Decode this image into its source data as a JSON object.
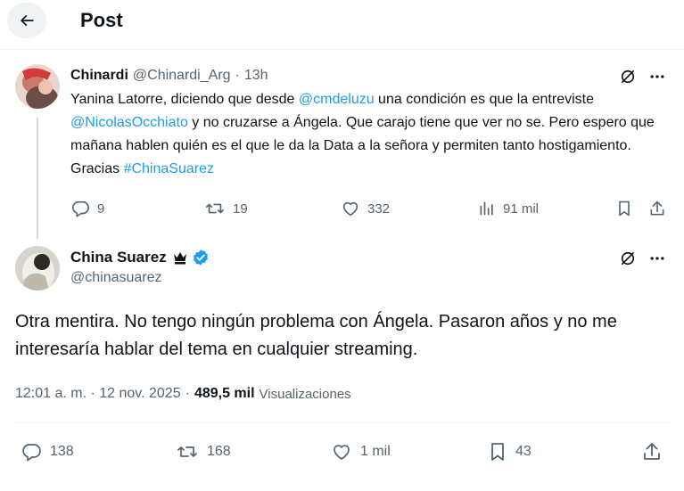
{
  "header": {
    "title": "Post"
  },
  "reply": {
    "author_name": "Chinardi",
    "author_handle": "@Chinardi_Arg",
    "separator": "·",
    "time": "13h",
    "text_parts": [
      {
        "text": "Yanina Latorre, diciendo que desde ",
        "link": false
      },
      {
        "text": "@cmdeluzu",
        "link": true
      },
      {
        "text": " una condición es que la entreviste ",
        "link": false
      },
      {
        "text": "@NicolasOcchiato",
        "link": true
      },
      {
        "text": " y no cruzarse a Ángela. Que carajo tiene que ver no se. Pero espero que mañana hablen quién es el que le da la Data a la señora y permiten tanto hostigamiento. Gracias ",
        "link": false
      },
      {
        "text": "#ChinaSuarez",
        "link": true
      }
    ],
    "stats": {
      "replies": "9",
      "reposts": "19",
      "likes": "332",
      "views": "91 mil"
    }
  },
  "main": {
    "author_name": "China Suarez",
    "author_handle": "@chinasuarez",
    "text": "Otra mentira. No tengo ningún problema con Ángela. Pasaron años y no me interesaría hablar del tema en cualquier streaming.",
    "timestamp": "12:01 a. m. · 12 nov. 2025",
    "separator": "·",
    "views_count": "489,5 mil",
    "views_label": "Visualizaciones",
    "stats": {
      "replies": "138",
      "reposts": "168",
      "likes": "1 mil",
      "bookmarks": "43"
    }
  },
  "colors": {
    "link": "#1d9bf0",
    "verified": "#1d9bf0",
    "muted": "#536471",
    "text": "#0f1419"
  },
  "icons": [
    "back-arrow-icon",
    "grok-icon",
    "more-icon",
    "reply-icon",
    "repost-icon",
    "like-icon",
    "views-icon",
    "bookmark-icon",
    "share-icon",
    "crown-icon",
    "verified-badge-icon"
  ]
}
